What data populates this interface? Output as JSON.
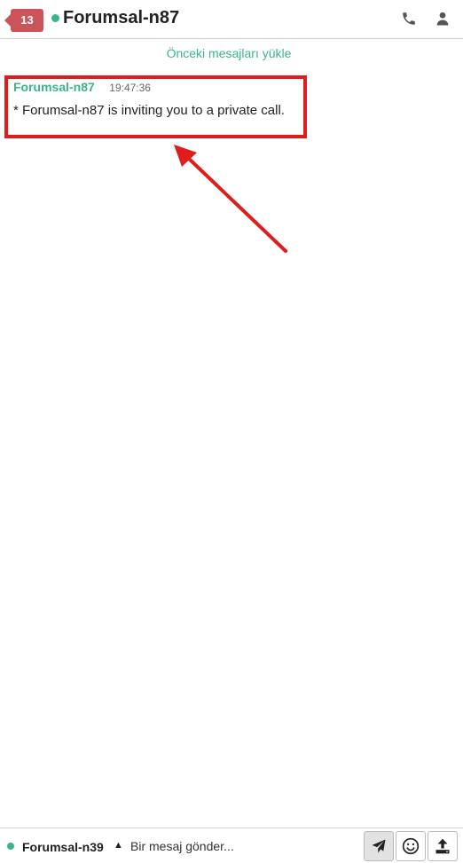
{
  "header": {
    "unread_count": "13",
    "title": "Forumsal-n87"
  },
  "chat": {
    "load_previous": "Önceki mesajları yükle",
    "messages": [
      {
        "author": "Forumsal-n87",
        "time": "19:47:36",
        "text": "* Forumsal-n87 is inviting you to a private call."
      }
    ]
  },
  "footer": {
    "current_user": "Forumsal-n39",
    "caret": "▲",
    "composer_placeholder": "Bir mesaj gönder..."
  },
  "icons": {
    "call": "phone-icon",
    "profile": "user-icon",
    "send": "send-icon",
    "emoji": "smile-icon",
    "upload": "upload-icon"
  },
  "colors": {
    "accent_green": "#3cb489",
    "badge_red": "#c9545a",
    "highlight_red": "#df1d1d"
  }
}
